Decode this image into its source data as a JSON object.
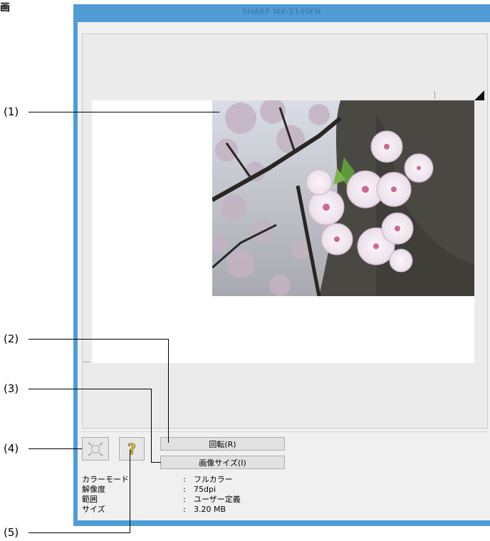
{
  "page_mark": "画",
  "window": {
    "title": "SHARP MX-5140FN"
  },
  "buttons": {
    "rotate_label": "回転(R)",
    "image_size_label": "画像サイズ(I)",
    "preview_icon": "preview-area-icon",
    "help_icon": "help-question-icon"
  },
  "info": {
    "rows": [
      {
        "label": "カラーモード",
        "sep": ":",
        "value": "フルカラー"
      },
      {
        "label": "解像度",
        "sep": ":",
        "value": "75dpi"
      },
      {
        "label": "範囲",
        "sep": ":",
        "value": "ユーザー定義"
      },
      {
        "label": "サイズ",
        "sep": ":",
        "value": "3.20 MB"
      }
    ]
  },
  "callouts": [
    "(1)",
    "(2)",
    "(3)",
    "(4)",
    "(5)"
  ],
  "colors": {
    "window_frame": "#4f9cd6",
    "client_bg": "#f0f0f0",
    "paper": "#ffffff"
  }
}
